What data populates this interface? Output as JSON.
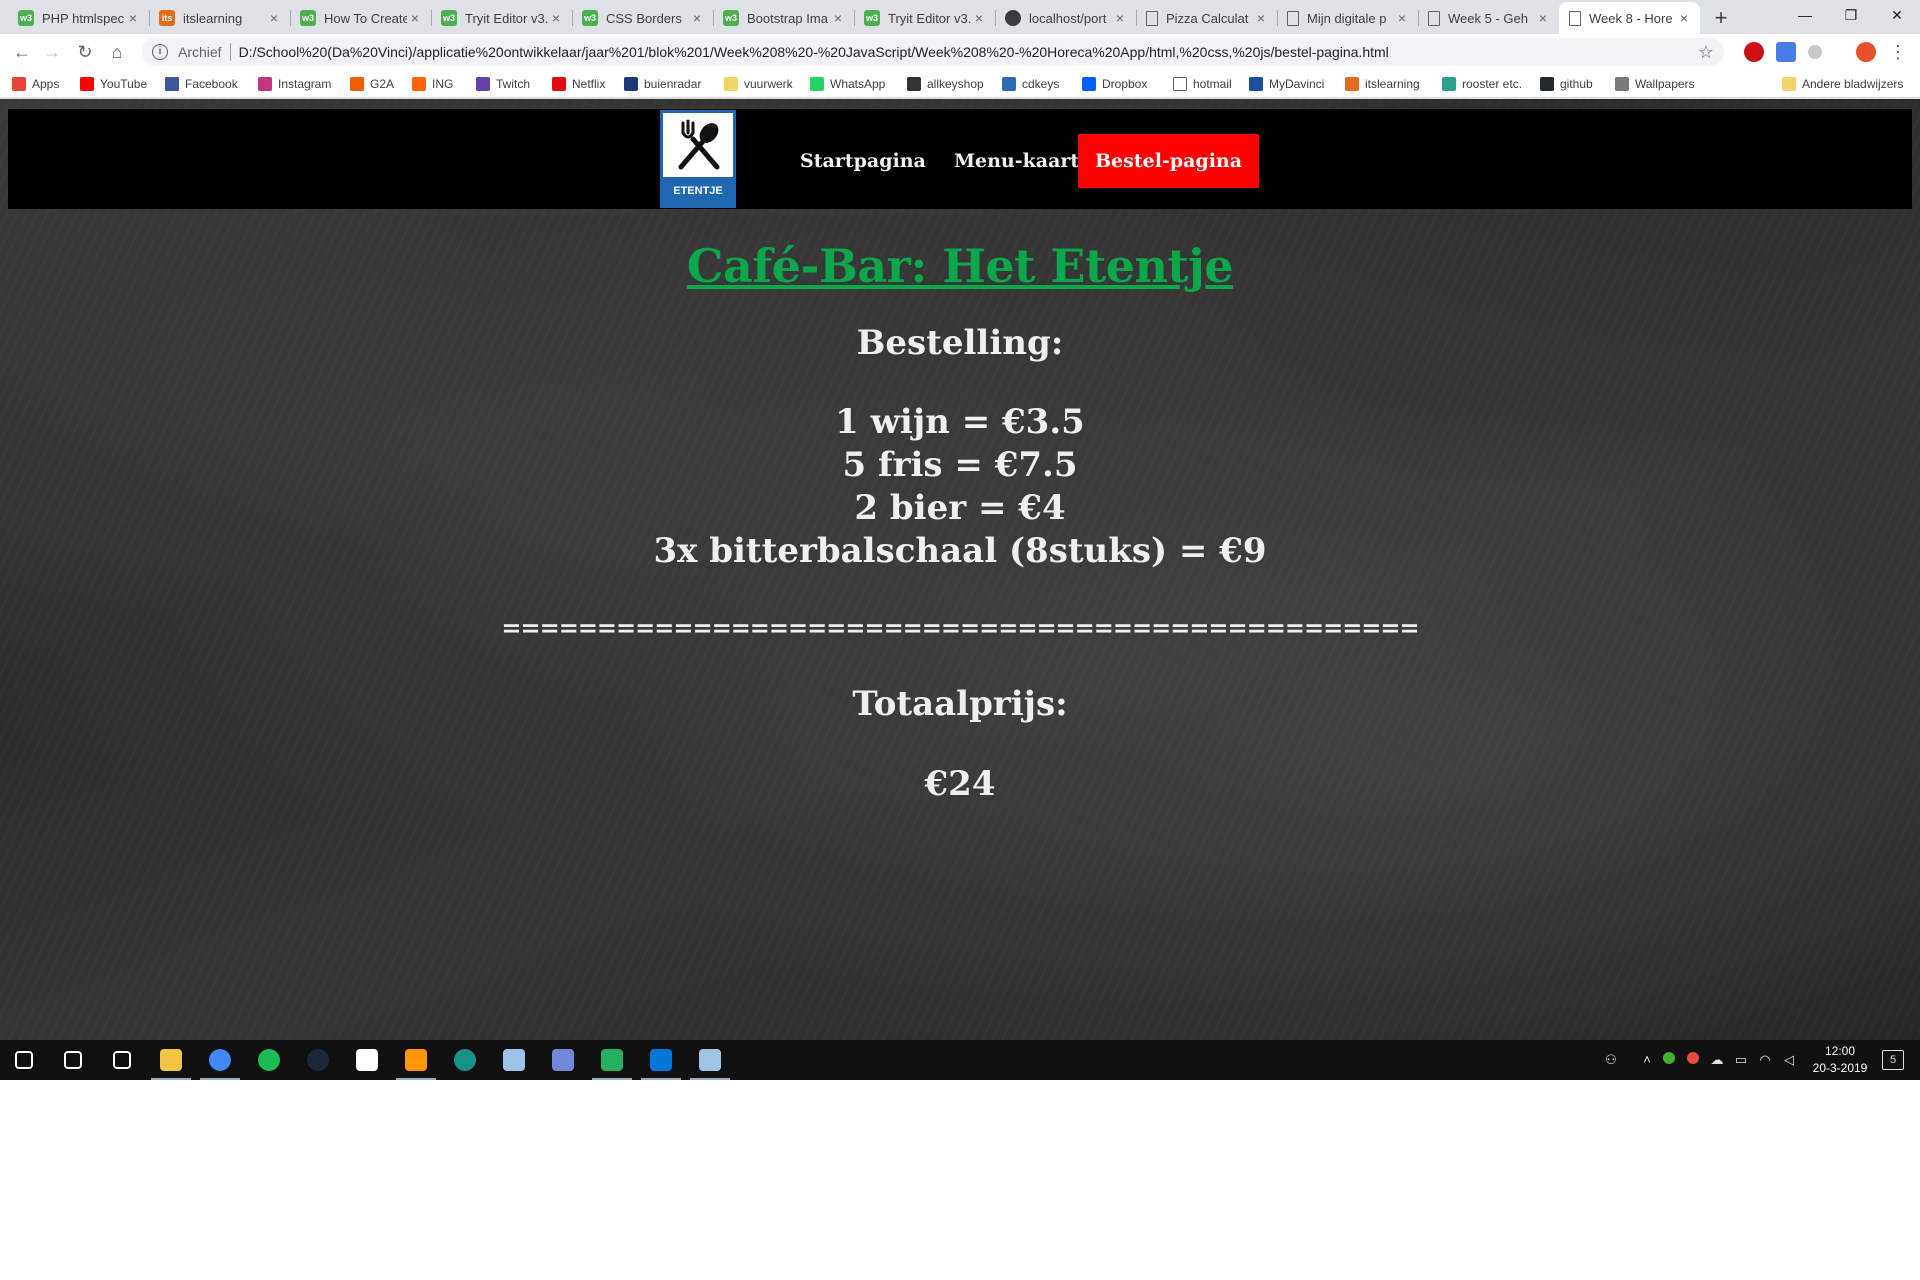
{
  "browser": {
    "tabs": [
      {
        "label": "PHP htmlspeci",
        "favicon": "w3schools-icon",
        "active": false
      },
      {
        "label": "itslearning",
        "favicon": "itslearning-icon",
        "active": false
      },
      {
        "label": "How To Create",
        "favicon": "w3schools-icon",
        "active": false
      },
      {
        "label": "Tryit Editor v3.",
        "favicon": "w3schools-icon",
        "active": false
      },
      {
        "label": "CSS Borders",
        "favicon": "w3schools-icon",
        "active": false
      },
      {
        "label": "Bootstrap Ima",
        "favicon": "w3schools-icon",
        "active": false
      },
      {
        "label": "Tryit Editor v3.",
        "favicon": "w3schools-icon",
        "active": false
      },
      {
        "label": "localhost/port",
        "favicon": "localhost-icon",
        "active": false
      },
      {
        "label": "Pizza Calculat",
        "favicon": "page-icon",
        "active": false
      },
      {
        "label": "Mijn digitale p",
        "favicon": "page-icon",
        "active": false
      },
      {
        "label": "Week 5 - Geh",
        "favicon": "page-icon",
        "active": false
      },
      {
        "label": "Week 8 - Hore",
        "favicon": "page-icon",
        "active": true
      }
    ],
    "new_tab_symbol": "+",
    "window_controls": {
      "minimize": "—",
      "restore": "❐",
      "close": "✕"
    },
    "address": {
      "security_label": "Archief",
      "url": "D:/School%20(Da%20Vinci)/applicatie%20ontwikkelaar/jaar%201/blok%201/Week%208%20-%20JavaScript/Week%208%20-%20Horeca%20App/html,%20css,%20js/bestel-pagina.html"
    },
    "bookmarks": [
      {
        "label": "Apps",
        "icon": "apps-grid-icon",
        "color": "#e94235"
      },
      {
        "label": "YouTube",
        "icon": "youtube-icon",
        "color": "#ff0000"
      },
      {
        "label": "Facebook",
        "icon": "facebook-icon",
        "color": "#3b5998"
      },
      {
        "label": "Instagram",
        "icon": "instagram-icon",
        "color": "#c13584"
      },
      {
        "label": "G2A",
        "icon": "g2a-icon",
        "color": "#f05f00"
      },
      {
        "label": "ING",
        "icon": "ing-icon",
        "color": "#ff6200"
      },
      {
        "label": "Twitch",
        "icon": "twitch-icon",
        "color": "#6441a5"
      },
      {
        "label": "Netflix",
        "icon": "netflix-icon",
        "color": "#e50914"
      },
      {
        "label": "buienradar",
        "icon": "buienradar-icon",
        "color": "#1c3a7a"
      },
      {
        "label": "vuurwerk",
        "icon": "folder-icon",
        "color": "#f2d46b"
      },
      {
        "label": "WhatsApp",
        "icon": "whatsapp-icon",
        "color": "#25d366"
      },
      {
        "label": "allkeyshop",
        "icon": "allkeyshop-icon",
        "color": "#333333"
      },
      {
        "label": "cdkeys",
        "icon": "cdkeys-icon",
        "color": "#2b6cb0"
      },
      {
        "label": "Dropbox",
        "icon": "dropbox-icon",
        "color": "#0061ff"
      },
      {
        "label": "hotmail",
        "icon": "page-icon",
        "color": "#ffffff"
      },
      {
        "label": "MyDavinci",
        "icon": "mydavinci-icon",
        "color": "#1f4e9b"
      },
      {
        "label": "itslearning",
        "icon": "itslearning-icon",
        "color": "#e26b1d"
      },
      {
        "label": "rooster etc.",
        "icon": "rooster-icon",
        "color": "#2f9e8a"
      },
      {
        "label": "github",
        "icon": "github-icon",
        "color": "#24292e"
      },
      {
        "label": "Wallpapers",
        "icon": "wallpapers-icon",
        "color": "#7a7a7a"
      }
    ],
    "other_bookmarks": "Andere bladwijzers"
  },
  "site": {
    "logo_text": "ETENTJE",
    "nav": [
      {
        "label": "Startpagina",
        "active": false
      },
      {
        "label": "Menu-kaart",
        "active": false
      },
      {
        "label": "Bestel-pagina",
        "active": true
      }
    ],
    "title": "Café-Bar: Het Etentje",
    "order_heading": "Bestelling:",
    "order_lines": [
      "1 wijn = €3.5",
      "5 fris = €7.5",
      "2 bier = €4",
      "3x bitterbalschaal (8stuks) = €9"
    ],
    "separator": "================================================",
    "total_heading": "Totaalprijs:",
    "total_value": "€24"
  },
  "taskbar": {
    "apps": [
      {
        "name": "windows-start-icon",
        "color": "#ffffff",
        "open": false
      },
      {
        "name": "search-icon",
        "color": "#ffffff",
        "open": false
      },
      {
        "name": "task-view-icon",
        "color": "#ffffff",
        "open": false
      },
      {
        "name": "file-explorer-icon",
        "color": "#f4c542",
        "open": true
      },
      {
        "name": "chrome-icon",
        "color": "#4285f4",
        "open": true
      },
      {
        "name": "spotify-icon",
        "color": "#1db954",
        "open": false
      },
      {
        "name": "steam-icon",
        "color": "#1b2838",
        "open": false
      },
      {
        "name": "mail-icon",
        "color": "#ffffff",
        "open": false
      },
      {
        "name": "sublime-text-icon",
        "color": "#ff9800",
        "open": true
      },
      {
        "name": "gitkraken-icon",
        "color": "#179287",
        "open": false
      },
      {
        "name": "paint-icon",
        "color": "#9ec1e8",
        "open": false
      },
      {
        "name": "discord-icon",
        "color": "#7289da",
        "open": false
      },
      {
        "name": "photos-icon",
        "color": "#27ae60",
        "open": true
      },
      {
        "name": "edge-icon",
        "color": "#0078d7",
        "open": true
      },
      {
        "name": "settings-icon",
        "color": "#a0c4e4",
        "open": true
      }
    ],
    "time": "12:00",
    "date": "20-3-2019",
    "notifications": "5"
  }
}
